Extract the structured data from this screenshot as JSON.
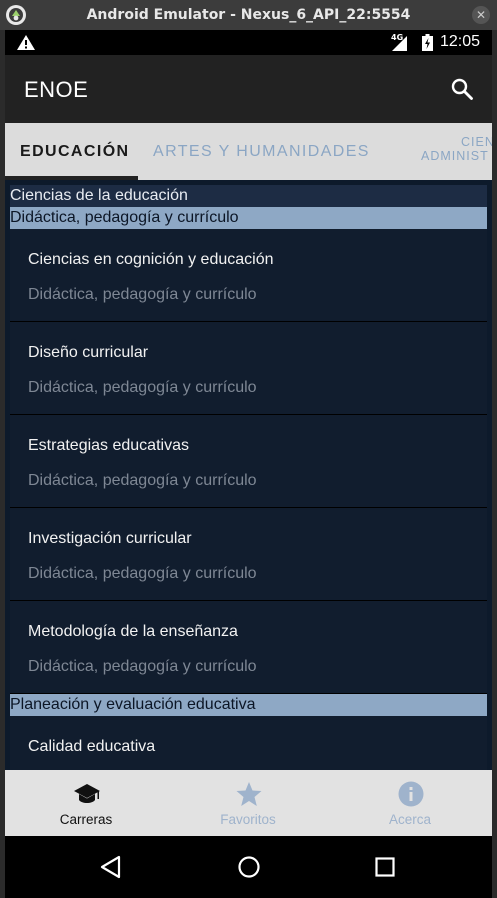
{
  "window": {
    "title": "Android Emulator - Nexus_6_API_22:5554"
  },
  "statusbar": {
    "network": "4G",
    "time": "12:05"
  },
  "appbar": {
    "title": "ENOE"
  },
  "tabs": [
    {
      "label": "EDUCACIÓN",
      "selected": true
    },
    {
      "label": "ARTES Y HUMANIDADES",
      "selected": false
    },
    {
      "label_line1": "CIEN",
      "label_line2": "ADMINIST",
      "selected": false
    }
  ],
  "list": {
    "area": "Ciencias de la educación",
    "groups": [
      {
        "header": "Didáctica, pedagogía y currículo",
        "items": [
          {
            "title": "Ciencias en cognición y educación",
            "subtitle": "Didáctica, pedagogía y currículo"
          },
          {
            "title": "Diseño curricular",
            "subtitle": "Didáctica, pedagogía y currículo"
          },
          {
            "title": "Estrategias educativas",
            "subtitle": "Didáctica, pedagogía y currículo"
          },
          {
            "title": "Investigación curricular",
            "subtitle": "Didáctica, pedagogía y currículo"
          },
          {
            "title": "Metodología de la enseñanza",
            "subtitle": "Didáctica, pedagogía y currículo"
          }
        ]
      },
      {
        "header": "Planeación y evaluación educativa",
        "items": [
          {
            "title": "Calidad educativa",
            "subtitle": ""
          }
        ]
      }
    ]
  },
  "bottom_nav": [
    {
      "label": "Carreras",
      "icon": "graduation-cap-icon",
      "active": true
    },
    {
      "label": "Favoritos",
      "icon": "star-icon",
      "active": false
    },
    {
      "label": "Acerca",
      "icon": "info-icon",
      "active": false
    }
  ],
  "colors": {
    "appbar": "#222222",
    "tabs_bg": "#dcdcdc",
    "tab_inactive": "#8ba6c4",
    "list_bg": "#0d1a2b",
    "section_light": "#8ea8c5",
    "section_dark": "#1d2c44",
    "bottom_nav_inactive": "#9fb3cc"
  }
}
